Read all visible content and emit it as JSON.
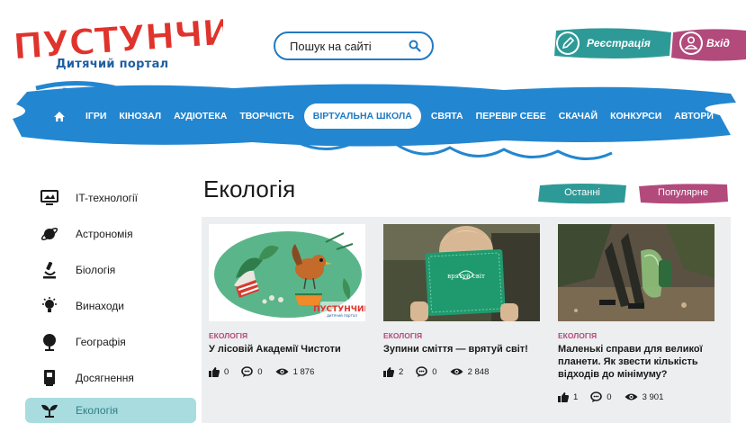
{
  "header": {
    "logo_text": "ПУСТУНЧИК",
    "logo_subtitle": "Дитячий портал",
    "search_placeholder": "Пошук на сайті",
    "register_label": "Реєстрація",
    "login_label": "Вхід"
  },
  "nav": {
    "items": [
      {
        "label": "ІГРИ"
      },
      {
        "label": "КІНОЗАЛ"
      },
      {
        "label": "АУДІОТЕКА"
      },
      {
        "label": "ТВОРЧІСТЬ"
      },
      {
        "label": "ВІРТУАЛЬНА ШКОЛА",
        "active": true
      },
      {
        "label": "СВЯТА"
      },
      {
        "label": "ПЕРЕВІР СЕБЕ"
      },
      {
        "label": "СКАЧАЙ"
      },
      {
        "label": "КОНКУРСИ"
      },
      {
        "label": "АВТОРИ"
      }
    ]
  },
  "sidebar": {
    "items": [
      {
        "label": "IT-технології",
        "icon": "monitor-icon"
      },
      {
        "label": "Астрономія",
        "icon": "planet-icon"
      },
      {
        "label": "Біологія",
        "icon": "microscope-icon"
      },
      {
        "label": "Винаходи",
        "icon": "lightbulb-icon"
      },
      {
        "label": "Географія",
        "icon": "globe-icon"
      },
      {
        "label": "Досягнення",
        "icon": "book-icon"
      },
      {
        "label": "Екологія",
        "icon": "sprout-icon",
        "active": true
      }
    ]
  },
  "main": {
    "title": "Екологія",
    "tabs": [
      {
        "label": "Останні"
      },
      {
        "label": "Популярне"
      }
    ],
    "cards": [
      {
        "category": "ЕКОЛОГІЯ",
        "title": "У лісовій Академії Чистоти",
        "likes": "0",
        "comments": "0",
        "views": "1 876",
        "image_badge": "ПУСТУНЧИК",
        "image_badge_sub": "дитячий портал"
      },
      {
        "category": "ЕКОЛОГІЯ",
        "title": "Зупини сміття — врятуй світ!",
        "likes": "2",
        "comments": "0",
        "views": "2 848",
        "image_text": "врятуй світ"
      },
      {
        "category": "ЕКОЛОГІЯ",
        "title": "Маленькі справи для великої планети. Як звести кількість відходів до мінімуму?",
        "likes": "1",
        "comments": "0",
        "views": "3 901"
      }
    ]
  },
  "colors": {
    "brand_red": "#e0332c",
    "nav_blue": "#2386d0",
    "accent_teal": "#2e9a97",
    "accent_pink": "#b24a7c",
    "sidebar_active": "#a8dcdf"
  }
}
